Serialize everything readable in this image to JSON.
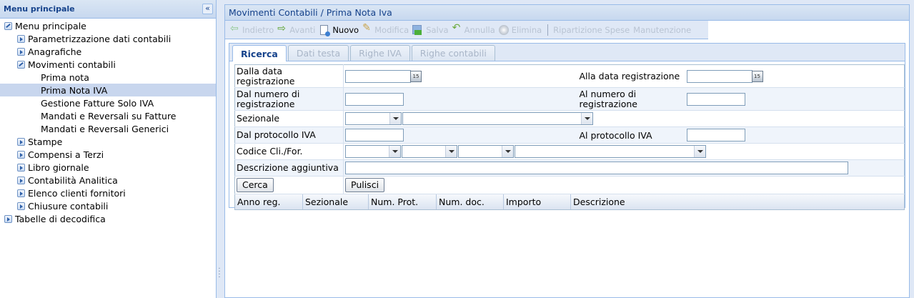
{
  "sidebar": {
    "title": "Menu principale",
    "collapse_icon": "«",
    "items": [
      {
        "label": "Menu principale",
        "level": 0,
        "state": "open"
      },
      {
        "label": "Parametrizzazione dati contabili",
        "level": 1,
        "state": "closed"
      },
      {
        "label": "Anagrafiche",
        "level": 1,
        "state": "closed"
      },
      {
        "label": "Movimenti contabili",
        "level": 1,
        "state": "open"
      },
      {
        "label": "Prima nota",
        "level": 2,
        "state": "leaf"
      },
      {
        "label": "Prima Nota IVA",
        "level": 2,
        "state": "leaf",
        "selected": true
      },
      {
        "label": "Gestione Fatture Solo IVA",
        "level": 2,
        "state": "leaf"
      },
      {
        "label": "Mandati e Reversali su Fatture",
        "level": 2,
        "state": "leaf"
      },
      {
        "label": "Mandati e Reversali Generici",
        "level": 2,
        "state": "leaf"
      },
      {
        "label": "Stampe",
        "level": 1,
        "state": "closed"
      },
      {
        "label": "Compensi a Terzi",
        "level": 1,
        "state": "closed"
      },
      {
        "label": "Libro giornale",
        "level": 1,
        "state": "closed"
      },
      {
        "label": "Contabilità Analitica",
        "level": 1,
        "state": "closed"
      },
      {
        "label": "Elenco clienti fornitori",
        "level": 1,
        "state": "closed"
      },
      {
        "label": "Chiusure contabili",
        "level": 1,
        "state": "closed"
      },
      {
        "label": "Tabelle di decodifica",
        "level": 0,
        "state": "closed"
      }
    ]
  },
  "main": {
    "title": "Movimenti Contabili / Prima Nota Iva",
    "toolbar": {
      "back": "Indietro",
      "forward": "Avanti",
      "new": "Nuovo",
      "edit": "Modifica",
      "save": "Salva",
      "cancel": "Annulla",
      "delete": "Elimina",
      "split": "Ripartizione Spese",
      "maintenance": "Manutenzione"
    },
    "tabs": [
      "Ricerca",
      "Dati testa",
      "Righe IVA",
      "Righe contabili"
    ],
    "active_tab": "Ricerca",
    "form": {
      "from_date_label": "Dalla data registrazione",
      "to_date_label": "Alla data registrazione",
      "from_number_label": "Dal numero di registrazione",
      "to_number_label": "Al numero di registrazione",
      "sezionale_label": "Sezionale",
      "from_protocol_label": "Dal protocollo IVA",
      "to_protocol_label": "Al protocollo IVA",
      "client_code_label": "Codice Cli./For.",
      "extra_desc_label": "Descrizione aggiuntiva",
      "calendar_icon": "15",
      "search_button": "Cerca",
      "clear_button": "Pulisci"
    },
    "grid_columns": [
      "Anno reg.",
      "Sezionale",
      "Num. Prot.",
      "Num. doc.",
      "Importo",
      "Descrizione"
    ]
  },
  "colors": {
    "header_text": "#15428b",
    "panel_border": "#99bbe8",
    "selected_row": "#c8d6ee",
    "background": "#dfe8f6"
  }
}
